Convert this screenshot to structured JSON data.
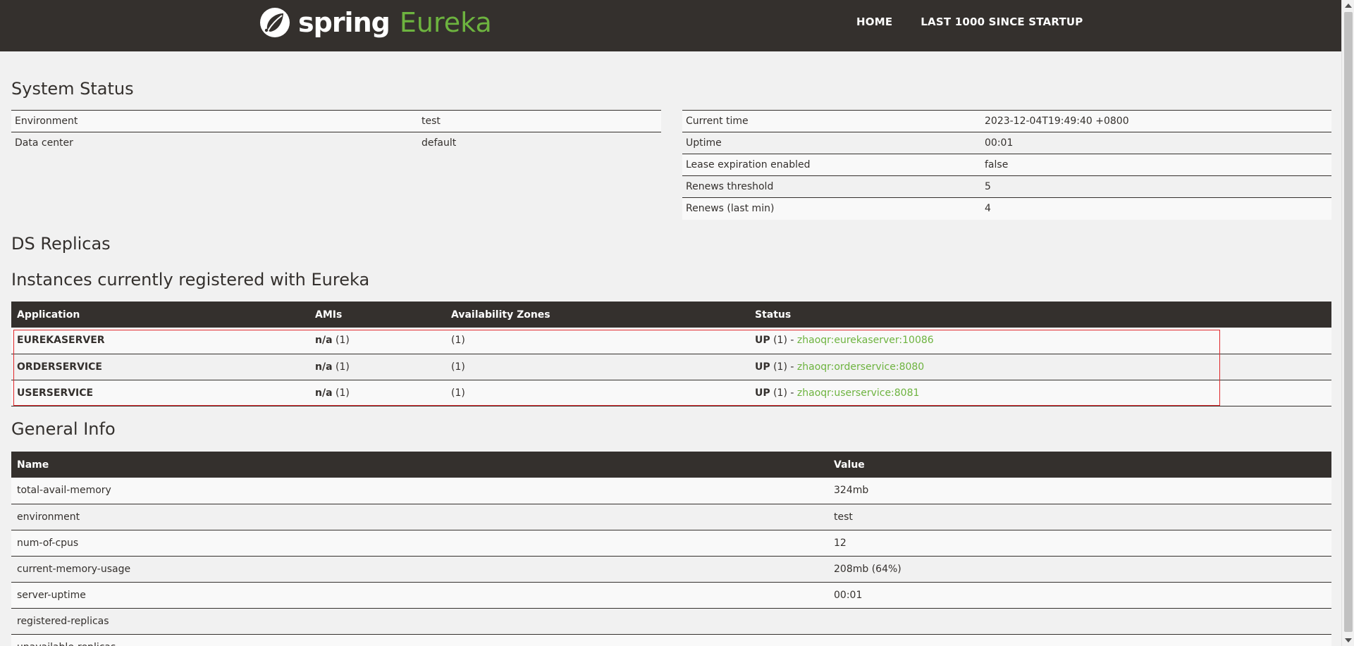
{
  "navbar": {
    "brand_spring": "spring",
    "brand_eureka": "Eureka",
    "links": [
      "HOME",
      "LAST 1000 SINCE STARTUP"
    ]
  },
  "system_status": {
    "title": "System Status",
    "left": [
      [
        "Environment",
        "test"
      ],
      [
        "Data center",
        "default"
      ]
    ],
    "right": [
      [
        "Current time",
        "2023-12-04T19:49:40 +0800"
      ],
      [
        "Uptime",
        "00:01"
      ],
      [
        "Lease expiration enabled",
        "false"
      ],
      [
        "Renews threshold",
        "5"
      ],
      [
        "Renews (last min)",
        "4"
      ]
    ]
  },
  "ds_replicas": {
    "title": "DS Replicas"
  },
  "instances": {
    "title": "Instances currently registered with Eureka",
    "headers": [
      "Application",
      "AMIs",
      "Availability Zones",
      "Status"
    ],
    "rows": [
      {
        "app": "EUREKASERVER",
        "ami_label": "n/a",
        "ami_count": "(1)",
        "zones": "(1)",
        "status": "UP",
        "status_count": "(1) - ",
        "link": "zhaoqr:eurekaserver:10086"
      },
      {
        "app": "ORDERSERVICE",
        "ami_label": "n/a",
        "ami_count": "(1)",
        "zones": "(1)",
        "status": "UP",
        "status_count": "(1) - ",
        "link": "zhaoqr:orderservice:8080"
      },
      {
        "app": "USERSERVICE",
        "ami_label": "n/a",
        "ami_count": "(1)",
        "zones": "(1)",
        "status": "UP",
        "status_count": "(1) - ",
        "link": "zhaoqr:userservice:8081"
      }
    ]
  },
  "general_info": {
    "title": "General Info",
    "headers": [
      "Name",
      "Value"
    ],
    "rows": [
      [
        "total-avail-memory",
        "324mb"
      ],
      [
        "environment",
        "test"
      ],
      [
        "num-of-cpus",
        "12"
      ],
      [
        "current-memory-usage",
        "208mb (64%)"
      ],
      [
        "server-uptime",
        "00:01"
      ],
      [
        "registered-replicas",
        ""
      ],
      [
        "unavailable-replicas",
        ""
      ]
    ]
  },
  "colors": {
    "navbar_bg": "#34302d",
    "accent_green": "#6db33f",
    "highlight_red": "#e0262a",
    "page_bg": "#f1f1f1"
  }
}
